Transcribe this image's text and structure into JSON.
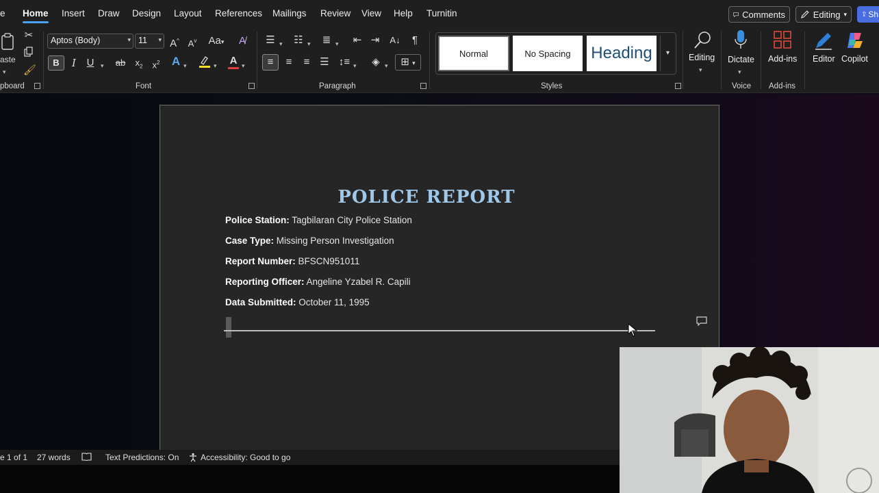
{
  "menubar": {
    "items": [
      "e",
      "Home",
      "Insert",
      "Draw",
      "Design",
      "Layout",
      "References",
      "Mailings",
      "Review",
      "View",
      "Help",
      "Turnitin"
    ],
    "active": "Home",
    "comments_label": "Comments",
    "editing_label": "Editing",
    "share_label": "Sh"
  },
  "ribbon": {
    "clipboard": {
      "paste_label": "aste",
      "group_label": "pboard"
    },
    "font": {
      "font_name": "Aptos (Body)",
      "font_size": "11",
      "group_label": "Font",
      "grow": "A",
      "shrink": "A",
      "change_case": "Aa",
      "bold": "B",
      "italic": "I",
      "underline": "U",
      "strike": "ab",
      "subscript": "x",
      "superscript": "x"
    },
    "paragraph": {
      "group_label": "Paragraph"
    },
    "styles": {
      "group_label": "Styles",
      "items": [
        "Normal",
        "No Spacing",
        "Heading"
      ]
    },
    "editing": {
      "label": "Editing"
    },
    "voice": {
      "dictate_label": "Dictate",
      "group_label": "Voice"
    },
    "addins": {
      "label": "Add-ins",
      "group_label": "Add-ins"
    },
    "editor": {
      "label": "Editor"
    },
    "copilot": {
      "label": "Copilot"
    }
  },
  "document": {
    "title": "POLICE REPORT",
    "fields": [
      {
        "label": "Police Station:",
        "value": "Tagbilaran City Police Station"
      },
      {
        "label": "Case Type:",
        "value": "Missing Person Investigation"
      },
      {
        "label": "Report Number:",
        "value": "BFSCN951011"
      },
      {
        "label": "Reporting Officer:",
        "value": "Angeline Yzabel R. Capili"
      },
      {
        "label": "Data Submitted:",
        "value": "October 11, 1995"
      }
    ]
  },
  "status": {
    "page": "e 1 of 1",
    "words": "27 words",
    "text_predictions": "Text Predictions: On",
    "accessibility": "Accessibility: Good to go"
  },
  "colors": {
    "title": "#9fc7e8",
    "accent_underline": "#4aa3f0",
    "share_button": "#4a6ee0"
  }
}
